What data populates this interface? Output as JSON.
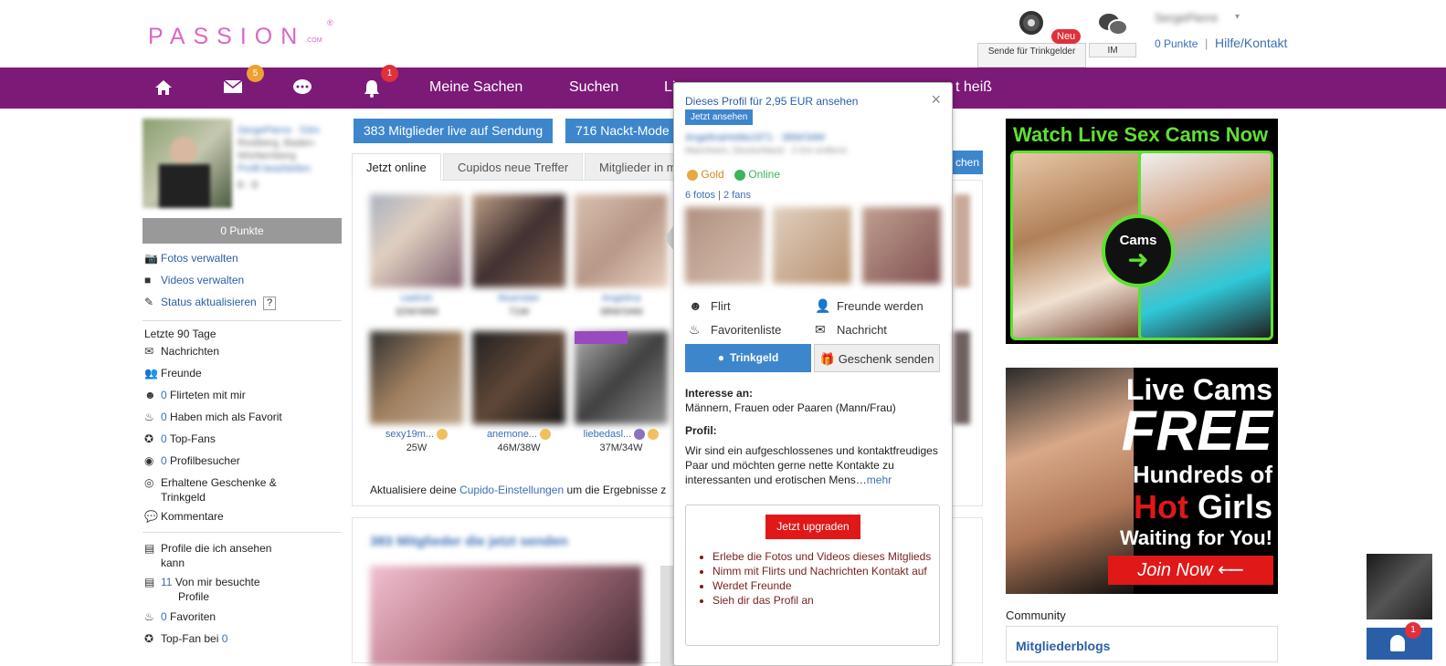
{
  "header": {
    "logo": "PASSION",
    "logo_com": ".COM",
    "logo_reg": "®",
    "tips_label": "Sende für Trinkgelder",
    "new_badge": "Neu",
    "im_label": "IM",
    "points": "0 Punkte",
    "separator": "|",
    "help": "Hilfe/Kontakt",
    "username": "SergePierre"
  },
  "nav": {
    "messages_badge": "5",
    "notifications_badge": "1",
    "items": [
      "Meine Sachen",
      "Suchen",
      "Li",
      "t heiß"
    ]
  },
  "sidebar": {
    "user_name": "SergePierre · 53m",
    "user_location": "Rostberg, Baden-Württemberg",
    "user_link": "Profil bearbeiten",
    "user_counts": "0 · 0",
    "points_bar": "0 Punkte",
    "manage_photos": "Fotos verwalten",
    "manage_videos": "Videos verwalten",
    "update_status": "Status aktualisieren",
    "help_q": "?",
    "last90": "Letzte 90 Tage",
    "rows": [
      {
        "count": "",
        "label": "Nachrichten"
      },
      {
        "count": "",
        "label": "Freunde"
      },
      {
        "count": "0",
        "label": "Flirteten mit mir"
      },
      {
        "count": "0",
        "label": "Haben mich als Favorit"
      },
      {
        "count": "0",
        "label": "Top-Fans"
      },
      {
        "count": "0",
        "label": "Profilbesucher"
      },
      {
        "count": "",
        "label": "Erhaltene Geschenke &"
      },
      {
        "count": "",
        "label": "Trinkgeld"
      },
      {
        "count": "",
        "label": "Kommentare"
      }
    ],
    "rows2": [
      {
        "count": "",
        "label": "Profile die ich ansehen"
      },
      {
        "count": "",
        "label": "kann"
      },
      {
        "count": "11",
        "label": "Von mir besuchte"
      },
      {
        "count": "",
        "label": "Profile"
      },
      {
        "count": "0",
        "label": "Favoriten"
      },
      {
        "count": "",
        "label": "Top-Fan bei",
        "tail": "0"
      }
    ]
  },
  "main": {
    "live_btn": "383 Mitglieder live auf Sendung",
    "nude_btn": "716 Nackt-Mode",
    "search_tail": "chen",
    "tabs": [
      "Jetzt online",
      "Cupidos neue Treffer",
      "Mitglieder in m"
    ],
    "row1": [
      {
        "name": "cadmin",
        "age": "32W/48M"
      },
      {
        "name": "Muenster",
        "age": "71W"
      },
      {
        "name": "Angelina",
        "age": "38W/34M"
      }
    ],
    "row2": [
      {
        "name": "sexy19m...",
        "age": "25W"
      },
      {
        "name": "anemone...",
        "age": "46M/38W"
      },
      {
        "name": "liebedasl...",
        "age": "37M/34W"
      }
    ],
    "update_pre": "Aktualisiere deine ",
    "update_link": "Cupido-Einstellungen",
    "update_post": " um die Ergebnisse z",
    "section_title": "383 Mitglieder die jetzt senden"
  },
  "popup": {
    "view_profile": "Dieses Profil für 2,95 EUR ansehen",
    "view_now": "Jetzt ansehen",
    "close": "×",
    "member_name": "AngelinaHottie1971 · 38W/34M",
    "member_loc": "Mannheim, Deutschland · 2 Km entfernt",
    "gold": "Gold",
    "online": "Online",
    "photos": "6 fotos",
    "sep": "|",
    "fans": "2 fans",
    "actions": {
      "flirt": "Flirt",
      "friends": "Freunde werden",
      "favorites": "Favoritenliste",
      "message": "Nachricht",
      "tip": "Trinkgeld",
      "gift": "Geschenk senden"
    },
    "interest_label": "Interesse an:",
    "interest_value": "Männern, Frauen oder Paaren (Mann/Frau)",
    "profile_label": "Profil:",
    "profile_text": "Wir sind ein aufgeschlossenes und kontaktfreudiges Paar und möchten gerne nette Kontakte zu interessanten und erotischen Mens…",
    "more": "mehr",
    "upgrade_btn": "Jetzt upgraden",
    "benefits": [
      "Erlebe die Fotos und Videos dieses Mitglieds",
      "Nimm mit Flirts und Nachrichten Kontakt auf",
      "Werdet Freunde",
      "Sieh dir das Profil an"
    ]
  },
  "ads": {
    "ad1_title": "Watch Live Sex Cams Now",
    "ad1_logo": "Cams",
    "ad2_l1": "Live Cams",
    "ad2_l2": "FREE",
    "ad2_l3": "Hundreds of",
    "ad2_hot": "Hot",
    "ad2_girls": " Girls",
    "ad2_l5": "Waiting for You!",
    "ad2_cta": "Join Now"
  },
  "community": {
    "title": "Community",
    "blogs": "Mitgliederblogs"
  },
  "corner_badge": "1"
}
